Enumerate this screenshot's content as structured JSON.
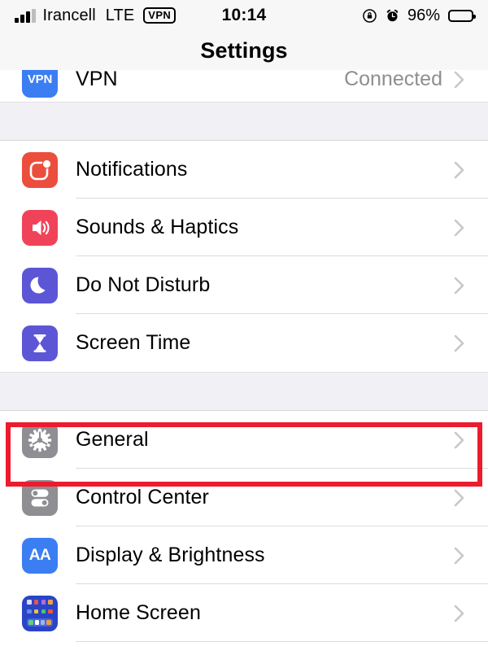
{
  "status_bar": {
    "carrier": "Irancell",
    "network_type": "LTE",
    "vpn_badge": "VPN",
    "time": "10:14",
    "battery_percent": "96%",
    "signal_bars_filled": 3,
    "signal_bars_total": 4,
    "icons": [
      "signal-bars-icon",
      "vpn-badge-icon",
      "rotation-lock-icon",
      "alarm-clock-icon",
      "battery-icon"
    ]
  },
  "header": {
    "title": "Settings"
  },
  "sections": [
    {
      "id": "vpn-section",
      "rows": [
        {
          "label": "VPN",
          "value": "Connected",
          "icon": "vpn-icon",
          "icon_text": "VPN",
          "icon_color": "#3B7EF2",
          "has_chevron": true
        }
      ]
    },
    {
      "id": "notifications-section",
      "rows": [
        {
          "label": "Notifications",
          "value": "",
          "icon": "notifications-icon",
          "icon_color": "#EB4E3D",
          "has_chevron": true
        },
        {
          "label": "Sounds & Haptics",
          "value": "",
          "icon": "sounds-icon",
          "icon_color": "#F04359",
          "has_chevron": true
        },
        {
          "label": "Do Not Disturb",
          "value": "",
          "icon": "moon-icon",
          "icon_color": "#5C56D6",
          "has_chevron": true
        },
        {
          "label": "Screen Time",
          "value": "",
          "icon": "hourglass-icon",
          "icon_color": "#5C56D6",
          "has_chevron": true
        }
      ]
    },
    {
      "id": "general-section",
      "rows": [
        {
          "label": "General",
          "value": "",
          "icon": "gear-icon",
          "icon_color": "#8E8E93",
          "has_chevron": true,
          "highlighted": true
        },
        {
          "label": "Control Center",
          "value": "",
          "icon": "control-center-icon",
          "icon_color": "#8E8E93",
          "has_chevron": true
        },
        {
          "label": "Display & Brightness",
          "value": "",
          "icon": "display-brightness-icon",
          "icon_text": "AA",
          "icon_color": "#3B7EF2",
          "has_chevron": true
        },
        {
          "label": "Home Screen",
          "value": "",
          "icon": "home-screen-icon",
          "icon_color": "#2A44C8",
          "has_chevron": true
        }
      ]
    }
  ],
  "highlight": {
    "target_label": "General",
    "color": "#ED1B2E",
    "border_width_px": 6
  },
  "colors": {
    "page_background": "#FFFFFF",
    "group_gap_background": "#F0F0F5",
    "status_bar_background": "#F7F7F8",
    "separator": "#DCDCE0",
    "secondary_text": "#8E8E93",
    "chevron": "#C7C7CC"
  }
}
